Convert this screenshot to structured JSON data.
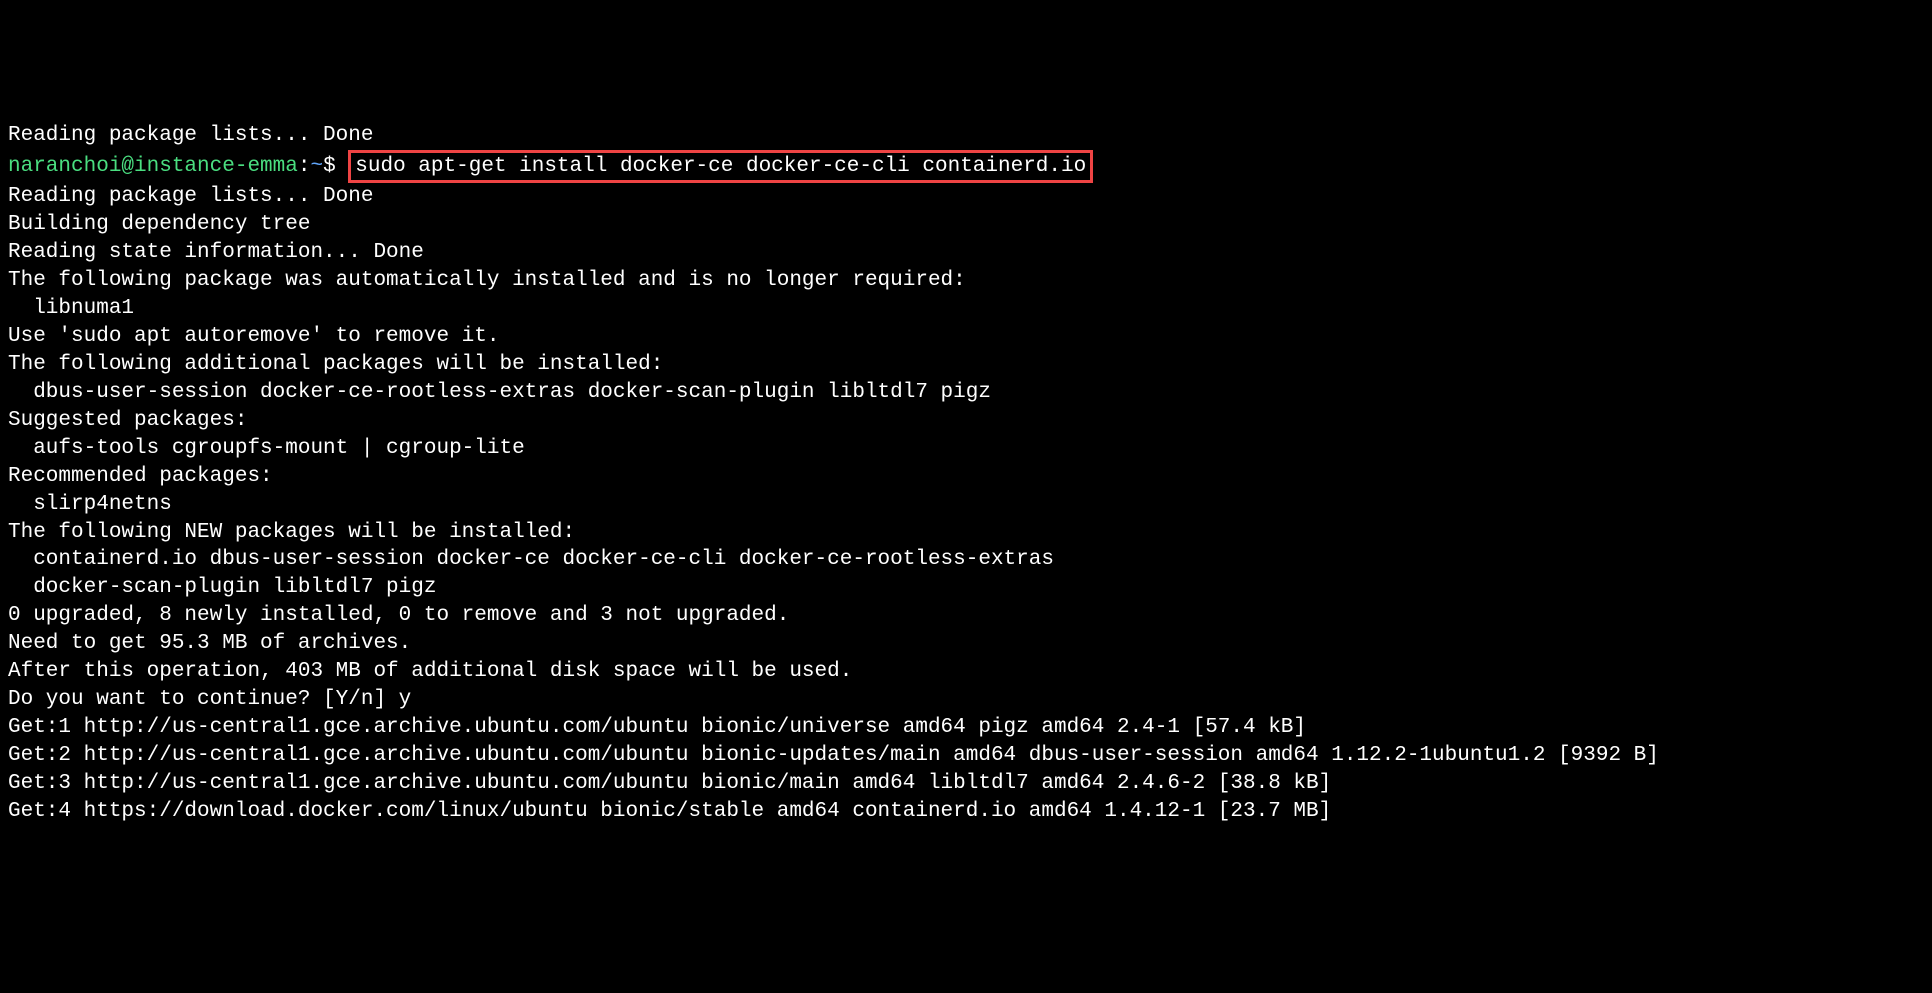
{
  "cutoff_line": "Reading package lists... Done",
  "prompt": {
    "user_host": "naranchoi@instance-emma",
    "colon": ":",
    "path": "~",
    "dollar": "$ "
  },
  "command": "sudo apt-get install docker-ce docker-ce-cli containerd.io",
  "output_lines": [
    "Reading package lists... Done",
    "Building dependency tree",
    "Reading state information... Done",
    "The following package was automatically installed and is no longer required:",
    "  libnuma1",
    "Use 'sudo apt autoremove' to remove it.",
    "The following additional packages will be installed:",
    "  dbus-user-session docker-ce-rootless-extras docker-scan-plugin libltdl7 pigz",
    "Suggested packages:",
    "  aufs-tools cgroupfs-mount | cgroup-lite",
    "Recommended packages:",
    "  slirp4netns",
    "The following NEW packages will be installed:",
    "  containerd.io dbus-user-session docker-ce docker-ce-cli docker-ce-rootless-extras",
    "  docker-scan-plugin libltdl7 pigz",
    "0 upgraded, 8 newly installed, 0 to remove and 3 not upgraded.",
    "Need to get 95.3 MB of archives.",
    "After this operation, 403 MB of additional disk space will be used.",
    "Do you want to continue? [Y/n] y",
    "Get:1 http://us-central1.gce.archive.ubuntu.com/ubuntu bionic/universe amd64 pigz amd64 2.4-1 [57.4 kB]",
    "Get:2 http://us-central1.gce.archive.ubuntu.com/ubuntu bionic-updates/main amd64 dbus-user-session amd64 1.12.2-1ubuntu1.2 [9392 B]",
    "Get:3 http://us-central1.gce.archive.ubuntu.com/ubuntu bionic/main amd64 libltdl7 amd64 2.4.6-2 [38.8 kB]",
    "Get:4 https://download.docker.com/linux/ubuntu bionic/stable amd64 containerd.io amd64 1.4.12-1 [23.7 MB]"
  ]
}
